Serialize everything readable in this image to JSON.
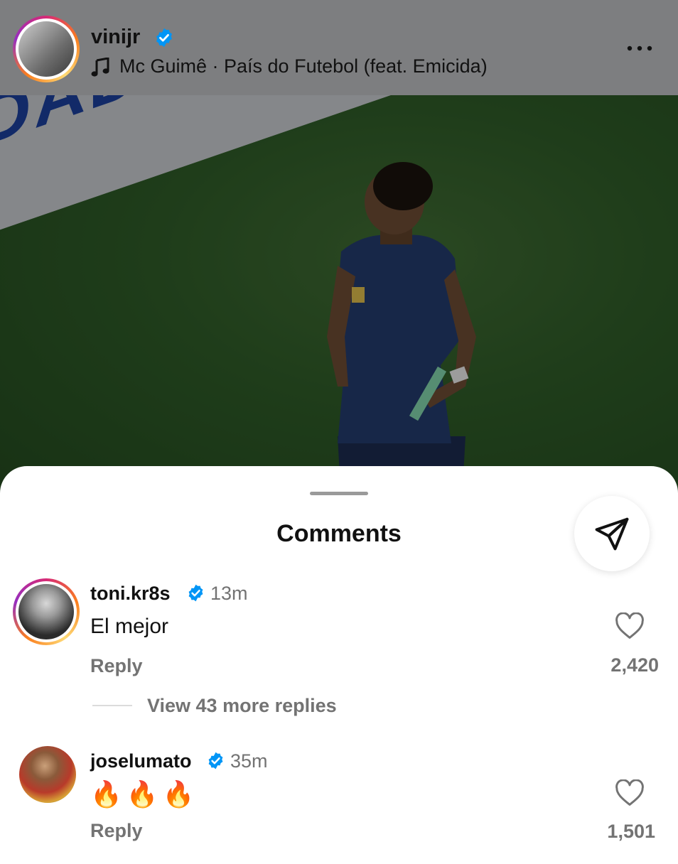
{
  "post": {
    "username": "vinijr",
    "music": "Mc Guimê · País do Futebol (feat. Emicida)",
    "board_text": "IDAD"
  },
  "comments_sheet": {
    "title": "Comments"
  },
  "comments": [
    {
      "username": "toni.kr8s",
      "time": "13m",
      "text": "El mejor",
      "reply_label": "Reply",
      "likes": "2,420",
      "view_replies": "View 43 more replies"
    },
    {
      "username": "joselumato",
      "time": "35m",
      "text": "🔥🔥🔥",
      "reply_label": "Reply",
      "likes": "1,501"
    }
  ],
  "icons": {
    "verified": "verified-badge-icon",
    "music": "music-note-icon",
    "more": "more-options-icon",
    "share": "send-icon",
    "like": "heart-icon"
  },
  "colors": {
    "verified_blue": "#0095f6",
    "secondary_text": "#737373",
    "header_overlay": "#7d7e80"
  }
}
